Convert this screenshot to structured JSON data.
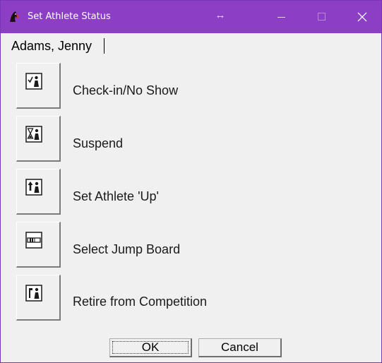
{
  "window": {
    "title": "Set Athlete Status",
    "icons": {
      "app": "horse-head-icon",
      "resize": "resize-arrows-icon",
      "minimize": "minimize-icon",
      "maximize": "maximize-icon",
      "close": "close-icon"
    },
    "accent_color": "#8c3ec5"
  },
  "athlete": {
    "name": "Adams, Jenny"
  },
  "actions": [
    {
      "label": "Check-in/No Show",
      "icon": "check-in-athlete-icon"
    },
    {
      "label": "Suspend",
      "icon": "suspend-hourglass-icon"
    },
    {
      "label": "Set Athlete 'Up'",
      "icon": "athlete-up-arrow-icon"
    },
    {
      "label": "Select Jump Board",
      "icon": "jump-board-icon"
    },
    {
      "label": "Retire from Competition",
      "icon": "retire-flag-icon"
    }
  ],
  "buttons": {
    "ok_label": "OK",
    "cancel_label": "Cancel"
  }
}
